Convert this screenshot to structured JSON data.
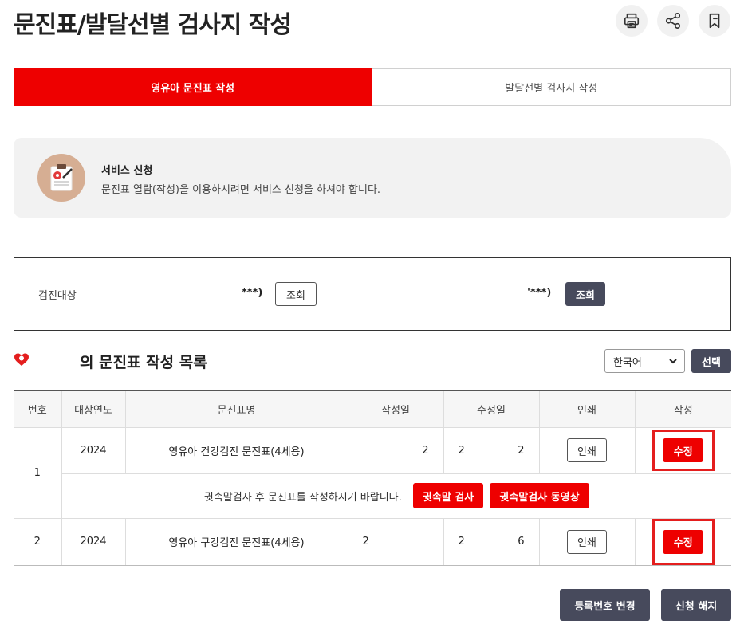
{
  "page": {
    "title": "문진표/발달선별 검사지 작성"
  },
  "top_actions": {
    "print_icon": "printer-icon",
    "share_icon": "share-icon",
    "bookmark_icon": "bookmark-icon"
  },
  "tabs": [
    {
      "label": "영유아 문진표 작성",
      "active": true
    },
    {
      "label": "발달선별 검사지 작성",
      "active": false
    }
  ],
  "service": {
    "title": "서비스 신청",
    "description": "문진표 열람(작성)을 이용하시려면 서비스 신청을 하셔야 합니다.",
    "icon": "clipboard-icon"
  },
  "target": {
    "label": "검진대상",
    "masked_1": "***)",
    "button_1": "조회",
    "masked_2": "'***)",
    "button_2": "조회"
  },
  "list": {
    "title": "의 문진표 작성 목록",
    "language_selected": "한국어",
    "select_button": "선택",
    "columns": [
      "번호",
      "대상연도",
      "문진표명",
      "작성일",
      "수정일",
      "인쇄",
      "작성"
    ],
    "rows": [
      {
        "no": "1",
        "year": "2024",
        "name": "영유아 건강검진 문진표(4세용)",
        "written": "2",
        "modified_a": "2",
        "modified_b": "2",
        "print": "인쇄",
        "edit": "수정",
        "notice": "귓속말검사 후 문진표를 작성하시기 바랍니다.",
        "notice_btn_1": "귓속말 검사",
        "notice_btn_2": "귓속말검사 동영상"
      },
      {
        "no": "2",
        "year": "2024",
        "name": "영유아 구강검진 문진표(4세용)",
        "written": "2",
        "modified_a": "2",
        "modified_b": "6",
        "print": "인쇄",
        "edit": "수정"
      }
    ]
  },
  "bottom": {
    "change_reg": "등록번호 변경",
    "cancel": "신청 해지"
  },
  "colors": {
    "accent": "#ee0000",
    "dark_button": "#474a5c",
    "highlight_box": "#e41e1e"
  }
}
